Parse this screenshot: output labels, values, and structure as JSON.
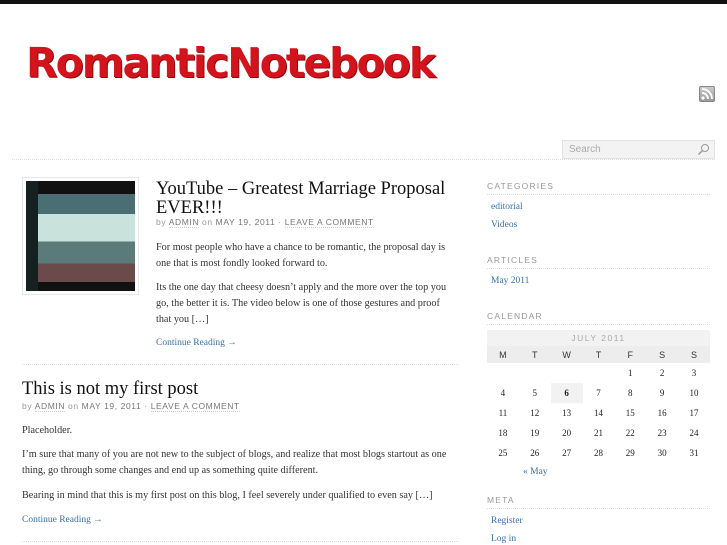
{
  "site": {
    "logo_text": "RomanticNotebook"
  },
  "header": {
    "search_placeholder": "Search"
  },
  "posts": [
    {
      "title": "YouTube – Greatest Marriage Proposal EVER!!!",
      "by": "by",
      "author": "ADMIN",
      "on": "on",
      "date": "MAY 19, 2011",
      "dot": "·",
      "comment": "LEAVE A COMMENT",
      "paragraphs": [
        "For most people who have a chance to be romantic, the proposal day is one that is most fondly looked forward to.",
        "Its the one day that cheesy doesn’t apply and the more over the top you go, the better it is. The video below is one of those gestures and proof that you […]"
      ],
      "more": "Continue Reading →"
    },
    {
      "title": "This is not my first post",
      "by": "by",
      "author": "ADMIN",
      "on": "on",
      "date": "MAY 19, 2011",
      "dot": "·",
      "comment": "LEAVE A COMMENT",
      "paragraphs": [
        "Placeholder.",
        "I’m sure that many of you are not new to the subject of blogs, and realize that most blogs startout as one thing, go through some changes and end up as something quite different.",
        "Bearing in mind that this is my first post on this blog, I feel severely under qualified to even say […]"
      ],
      "more": "Continue Reading →"
    }
  ],
  "sidebar": {
    "categories": {
      "title": "CATEGORIES",
      "items": [
        "editorial",
        "Videos"
      ]
    },
    "articles": {
      "title": "ARTICLES",
      "items": [
        "May 2011"
      ]
    },
    "calendar": {
      "title": "CALENDAR",
      "caption": "JULY 2011",
      "days": [
        "M",
        "T",
        "W",
        "T",
        "F",
        "S",
        "S"
      ],
      "weeks": [
        [
          "",
          "",
          "",
          "",
          "1",
          "2",
          "3"
        ],
        [
          "4",
          "5",
          "6",
          "7",
          "8",
          "9",
          "10"
        ],
        [
          "11",
          "12",
          "13",
          "14",
          "15",
          "16",
          "17"
        ],
        [
          "18",
          "19",
          "20",
          "21",
          "22",
          "23",
          "24"
        ],
        [
          "25",
          "26",
          "27",
          "28",
          "29",
          "30",
          "31"
        ]
      ],
      "today": "6",
      "prev": "« May"
    },
    "meta": {
      "title": "META",
      "items": [
        "Register",
        "Log in"
      ]
    }
  }
}
